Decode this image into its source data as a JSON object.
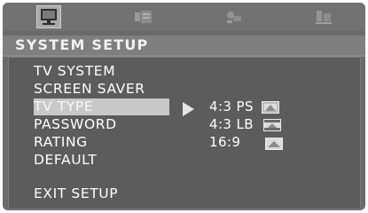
{
  "tabs": [
    {
      "icon": "monitor-icon",
      "active": true
    },
    {
      "icon": "audio-settings-icon",
      "active": false
    },
    {
      "icon": "video-settings-icon",
      "active": false
    },
    {
      "icon": "preference-icon",
      "active": false
    }
  ],
  "header": {
    "title": "SYSTEM SETUP"
  },
  "menu": {
    "items": [
      {
        "label": "TV SYSTEM"
      },
      {
        "label": "SCREEN SAVER"
      },
      {
        "label": "TV TYPE",
        "selected": true
      },
      {
        "label": "PASSWORD"
      },
      {
        "label": "RATING"
      },
      {
        "label": "DEFAULT"
      }
    ],
    "exit_label": "EXIT SETUP"
  },
  "submenu": {
    "options": [
      {
        "label": "4:3 PS",
        "icon": "pan-scan-icon"
      },
      {
        "label": "4:3 LB",
        "icon": "letterbox-icon"
      },
      {
        "label": "16:9",
        "icon": "widescreen-icon"
      }
    ]
  },
  "colors": {
    "background": "#6a6a6a",
    "highlight": "#bdbdbd",
    "text": "#ffffff"
  }
}
